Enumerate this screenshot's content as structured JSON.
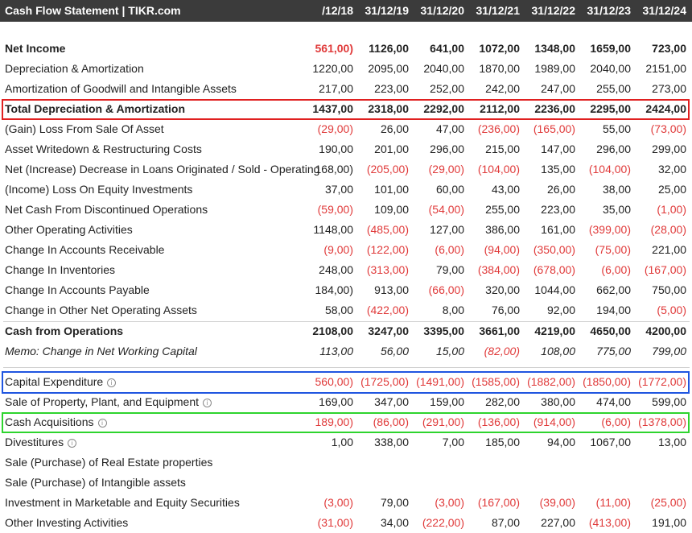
{
  "header": {
    "title": "Cash Flow Statement | TIKR.com",
    "columns": [
      "/12/18",
      "31/12/19",
      "31/12/20",
      "31/12/21",
      "31/12/22",
      "31/12/23",
      "31/12/24"
    ]
  },
  "rows": [
    {
      "label": "Net Income",
      "bold": true,
      "values": [
        "561,00)",
        "1126,00",
        "641,00",
        "1072,00",
        "1348,00",
        "1659,00",
        "723,00"
      ]
    },
    {
      "label": "Depreciation & Amortization",
      "values": [
        "1220,00",
        "2095,00",
        "2040,00",
        "1870,00",
        "1989,00",
        "2040,00",
        "2151,00"
      ]
    },
    {
      "label": "Amortization of Goodwill and Intangible Assets",
      "values": [
        "217,00",
        "223,00",
        "252,00",
        "242,00",
        "247,00",
        "255,00",
        "273,00"
      ]
    },
    {
      "label": "Total Depreciation & Amortization",
      "bold": true,
      "values": [
        "1437,00",
        "2318,00",
        "2292,00",
        "2112,00",
        "2236,00",
        "2295,00",
        "2424,00"
      ]
    },
    {
      "label": "(Gain) Loss From Sale Of Asset",
      "values": [
        "(29,00)",
        "26,00",
        "47,00",
        "(236,00)",
        "(165,00)",
        "55,00",
        "(73,00)"
      ]
    },
    {
      "label": "Asset Writedown & Restructuring Costs",
      "values": [
        "190,00",
        "201,00",
        "296,00",
        "215,00",
        "147,00",
        "296,00",
        "299,00"
      ]
    },
    {
      "label": "Net (Increase) Decrease in Loans Originated / Sold - Operating",
      "values": [
        "168,00)",
        "(205,00)",
        "(29,00)",
        "(104,00)",
        "135,00",
        "(104,00)",
        "32,00"
      ]
    },
    {
      "label": "(Income) Loss On Equity Investments",
      "values": [
        "37,00",
        "101,00",
        "60,00",
        "43,00",
        "26,00",
        "38,00",
        "25,00"
      ]
    },
    {
      "label": "Net Cash From Discontinued Operations",
      "values": [
        "(59,00)",
        "109,00",
        "(54,00)",
        "255,00",
        "223,00",
        "35,00",
        "(1,00)"
      ]
    },
    {
      "label": "Other Operating Activities",
      "values": [
        "1148,00",
        "(485,00)",
        "127,00",
        "386,00",
        "161,00",
        "(399,00)",
        "(28,00)"
      ]
    },
    {
      "label": "Change In Accounts Receivable",
      "values": [
        "(9,00)",
        "(122,00)",
        "(6,00)",
        "(94,00)",
        "(350,00)",
        "(75,00)",
        "221,00"
      ]
    },
    {
      "label": "Change In Inventories",
      "values": [
        "248,00",
        "(313,00)",
        "79,00",
        "(384,00)",
        "(678,00)",
        "(6,00)",
        "(167,00)"
      ]
    },
    {
      "label": "Change In Accounts Payable",
      "values": [
        "184,00)",
        "913,00",
        "(66,00)",
        "320,00",
        "1044,00",
        "662,00",
        "750,00"
      ]
    },
    {
      "label": "Change in Other Net Operating Assets",
      "values": [
        "58,00",
        "(422,00)",
        "8,00",
        "76,00",
        "92,00",
        "194,00",
        "(5,00)"
      ]
    },
    {
      "label": "Cash from Operations",
      "bold": true,
      "values": [
        "2108,00",
        "3247,00",
        "3395,00",
        "3661,00",
        "4219,00",
        "4650,00",
        "4200,00"
      ]
    },
    {
      "label": "Memo: Change in Net Working Capital",
      "italic": true,
      "values": [
        "113,00",
        "56,00",
        "15,00",
        "(82,00)",
        "108,00",
        "775,00",
        "799,00"
      ]
    },
    {
      "label": "Capital Expenditure",
      "info": true,
      "values": [
        "560,00)",
        "(1725,00)",
        "(1491,00)",
        "(1585,00)",
        "(1882,00)",
        "(1850,00)",
        "(1772,00)"
      ]
    },
    {
      "label": "Sale of Property, Plant, and Equipment",
      "info": true,
      "values": [
        "169,00",
        "347,00",
        "159,00",
        "282,00",
        "380,00",
        "474,00",
        "599,00"
      ]
    },
    {
      "label": "Cash Acquisitions",
      "info": true,
      "values": [
        "189,00)",
        "(86,00)",
        "(291,00)",
        "(136,00)",
        "(914,00)",
        "(6,00)",
        "(1378,00)"
      ]
    },
    {
      "label": "Divestitures",
      "info": true,
      "values": [
        "1,00",
        "338,00",
        "7,00",
        "185,00",
        "94,00",
        "1067,00",
        "13,00"
      ]
    },
    {
      "label": "Sale (Purchase) of Real Estate properties",
      "values": [
        "",
        "",
        "",
        "",
        "",
        "",
        ""
      ]
    },
    {
      "label": "Sale (Purchase) of Intangible assets",
      "values": [
        "",
        "",
        "",
        "",
        "",
        "",
        ""
      ]
    },
    {
      "label": "Investment in Marketable and Equity Securities",
      "values": [
        "(3,00)",
        "79,00",
        "(3,00)",
        "(167,00)",
        "(39,00)",
        "(11,00)",
        "(25,00)"
      ]
    },
    {
      "label": "Other Investing Activities",
      "values": [
        "(31,00)",
        "34,00",
        "(222,00)",
        "87,00",
        "227,00",
        "(413,00)",
        "191,00"
      ]
    }
  ],
  "negative_red_rows_first_col": [
    0,
    16,
    18
  ],
  "colors": {
    "header_bg": "#3b3b3b",
    "negative": "#e03a3a",
    "highlight_red": "#e02020",
    "highlight_blue": "#1f55e0",
    "highlight_green": "#2ed42e"
  }
}
